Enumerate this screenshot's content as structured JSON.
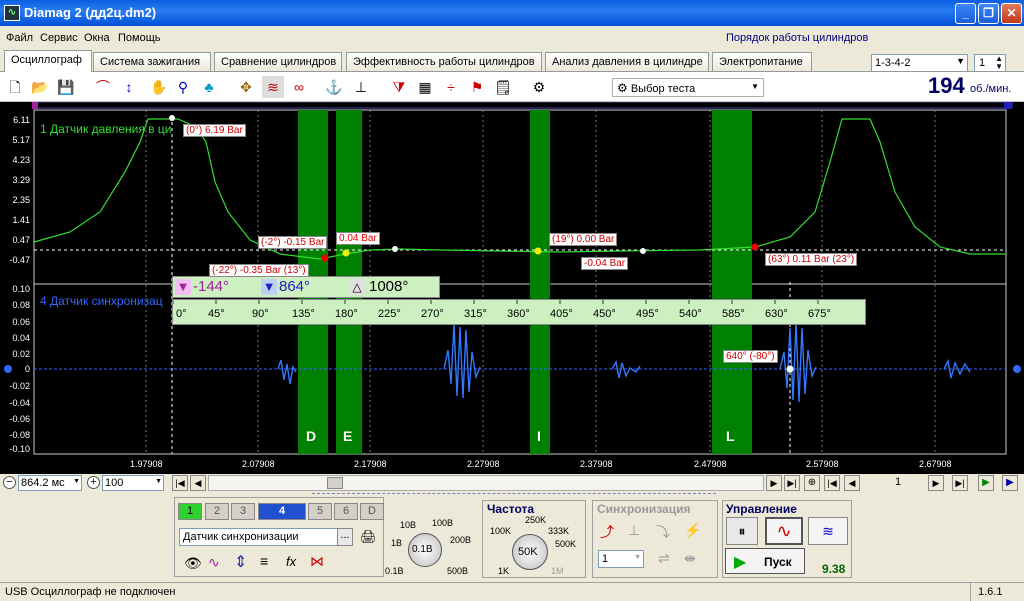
{
  "window": {
    "title": "Diamag 2 (дд2ц.dm2)"
  },
  "menu": [
    "Файл",
    "Сервис",
    "Окна",
    "Помощь"
  ],
  "cylinder_order": {
    "label": "Порядок работы цилиндров",
    "value": "1-3-4-2",
    "count": "1"
  },
  "tabs": [
    "Осциллограф",
    "Система зажигания",
    "Сравнение цилиндров",
    "Эффективность работы цилиндров",
    "Анализ давления в цилиндре",
    "Электропитание"
  ],
  "toolbar": {
    "test_select": "Выбор теста",
    "rpm": "194",
    "rpm_unit": "об./мин."
  },
  "channel1": {
    "label": "1 Датчик давления в ци",
    "y_ticks": [
      "6.11",
      "5.17",
      "4.23",
      "3.29",
      "2.35",
      "1.41",
      "0.47",
      "-0.47"
    ]
  },
  "channel4": {
    "label": "4 Датчик синхронизац",
    "y_ticks": [
      "0.10",
      "0.08",
      "0.06",
      "0.04",
      "0.02",
      "0",
      "-0.02",
      "-0.04",
      "-0.06",
      "-0.08",
      "-0.10"
    ]
  },
  "callouts": {
    "c1": "(0°) 6.19 Bar",
    "c2": "(-2°) -0.15 Bar",
    "c3": "0.04 Bar",
    "c4": "(-22°) -0.35 Bar (13°)",
    "c5": "(19°) 0.00 Bar",
    "c6": "-0.04 Bar",
    "c7": "(63°) 0.11 Bar (23°)",
    "c8": "640° (-80°)"
  },
  "markers": {
    "m1": "-144°",
    "m2": "864°",
    "delta": "1008°"
  },
  "degree_scale": [
    "0°",
    "45°",
    "90°",
    "135°",
    "180°",
    "225°",
    "270°",
    "315°",
    "360°",
    "405°",
    "450°",
    "495°",
    "540°",
    "585°",
    "630°",
    "675°"
  ],
  "zones": [
    "D",
    "E",
    "I",
    "L"
  ],
  "x_ticks": [
    "1.97908",
    "2.07908",
    "2.17908",
    "2.27908",
    "2.37908",
    "2.47908",
    "2.57908",
    "2.67908"
  ],
  "timebase": {
    "value": "864.2 мс",
    "zoom": "100",
    "page": "1"
  },
  "channels_panel": {
    "buttons": [
      "1",
      "2",
      "3",
      "4",
      "5",
      "6",
      "D"
    ],
    "sensor": "Датчик синхронизации",
    "ellipsis": "...",
    "voltage_labels": [
      "10В",
      "100В",
      "1В",
      "200В",
      "0.1В",
      "500В"
    ],
    "voltage_value": "0.1В"
  },
  "frequency_panel": {
    "title": "Частота",
    "labels": [
      "250K",
      "100K",
      "333K",
      "500K",
      "1K",
      "1M"
    ],
    "value": "50K"
  },
  "sync_panel": {
    "title": "Синхронизация",
    "value": "1"
  },
  "control_panel": {
    "title": "Управление",
    "start": "Пуск",
    "value": "9.38"
  },
  "status": {
    "text": "USB Осциллограф не подключен",
    "version": "1.6.1"
  }
}
